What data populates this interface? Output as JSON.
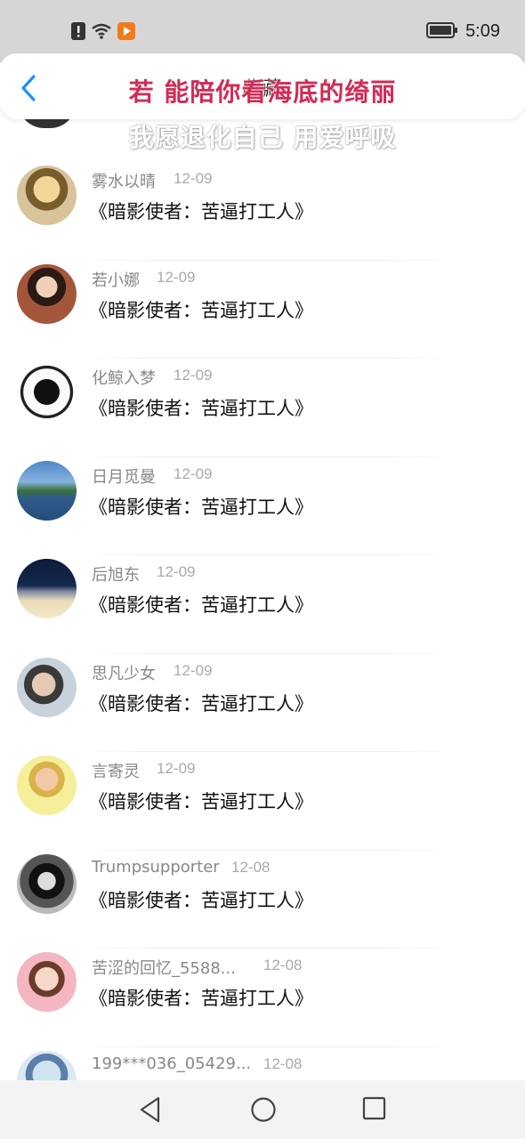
{
  "status_bar": {
    "time": "5:09",
    "icons": [
      "alert-icon",
      "wifi-icon",
      "video-app-icon",
      "battery-icon"
    ]
  },
  "header": {
    "title": "收藏",
    "back_icon": "chevron-left-icon",
    "accent": "#1e90ff"
  },
  "overlay": {
    "line1": "若 能陪你看海底的绮丽",
    "line2": "我愿退化自己 用爱呼吸",
    "line1_color": "#d22b56"
  },
  "list": {
    "items": [
      {
        "name": "雾水以晴",
        "date": "12-09",
        "message": "《暗影使者：苦逼打工人》"
      },
      {
        "name": "若小娜",
        "date": "12-09",
        "message": "《暗影使者：苦逼打工人》"
      },
      {
        "name": "化鲸入梦",
        "date": "12-09",
        "message": "《暗影使者：苦逼打工人》"
      },
      {
        "name": "日月觅曼",
        "date": "12-09",
        "message": "《暗影使者：苦逼打工人》"
      },
      {
        "name": "后旭东",
        "date": "12-09",
        "message": "《暗影使者：苦逼打工人》"
      },
      {
        "name": "思凡少女",
        "date": "12-09",
        "message": "《暗影使者：苦逼打工人》"
      },
      {
        "name": "言寄灵",
        "date": "12-09",
        "message": "《暗影使者：苦逼打工人》"
      },
      {
        "name": "Trumpsupporter",
        "date": "12-08",
        "message": "《暗影使者：苦逼打工人》"
      },
      {
        "name": "苦涩的回忆_5588...",
        "date": "12-08",
        "message": "《暗影使者：苦逼打工人》"
      },
      {
        "name": "199***036_05429...",
        "date": "12-08",
        "message": ""
      }
    ]
  },
  "nav_bar": {
    "icons": [
      "back-triangle-icon",
      "home-circle-icon",
      "recents-square-icon"
    ]
  }
}
